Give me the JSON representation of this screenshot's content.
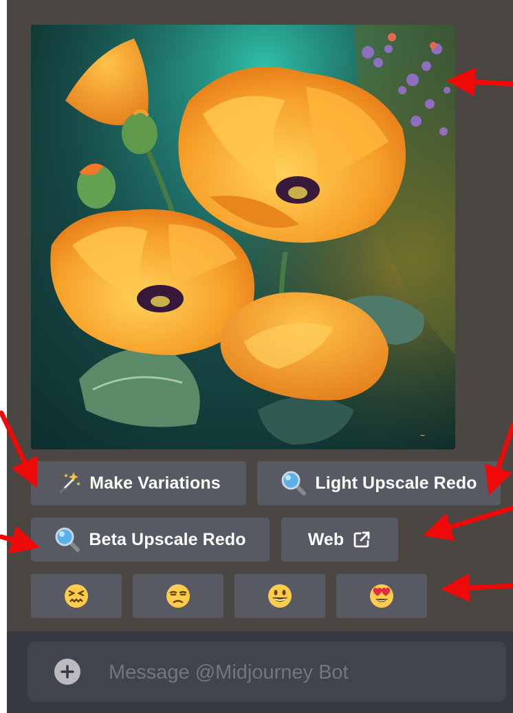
{
  "image": {
    "subject": "painted orange poppies with purple wildflowers",
    "colors": {
      "bloom": "#f39a22",
      "petal_light": "#ffc04a",
      "background": "#154442",
      "leaf": "#4f7a5f",
      "wildflower": "#8b5fbf"
    }
  },
  "buttons": {
    "make_variations": {
      "label": "Make Variations",
      "icon": "magic-wand-icon"
    },
    "light_upscale_redo": {
      "label": "Light Upscale Redo",
      "icon": "magnifying-glass-icon"
    },
    "beta_upscale_redo": {
      "label": "Beta Upscale Redo",
      "icon": "magnifying-glass-icon"
    },
    "web": {
      "label": "Web",
      "icon": "external-link-icon"
    }
  },
  "ratings": [
    {
      "icon": "confounded-face-icon",
      "glyph": "😖"
    },
    {
      "icon": "unamused-face-icon",
      "glyph": "😒"
    },
    {
      "icon": "grinning-face-icon",
      "glyph": "😀"
    },
    {
      "icon": "heart-eyes-face-icon",
      "glyph": "😍"
    }
  ],
  "composer": {
    "placeholder": "Message @Midjourney Bot",
    "icon": "plus-circle-icon"
  },
  "annotations": {
    "arrow_color": "#ef0a0a",
    "arrow_count": 6
  },
  "theme": {
    "panel_bg": "#4a4641",
    "button_bg": "#575963",
    "composer_bg": "#41444b"
  }
}
